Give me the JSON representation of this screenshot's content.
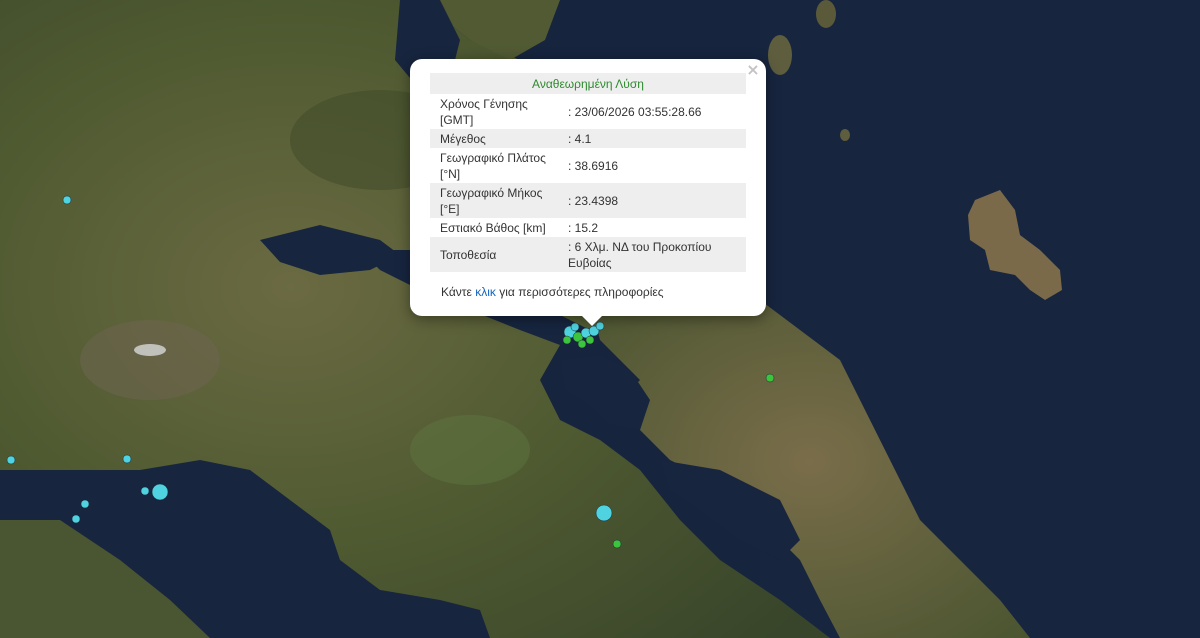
{
  "popup": {
    "title": "Αναθεωρημένη Λύση",
    "rows": [
      {
        "label": "Χρόνος Γένησης [GMT]",
        "value": ": 23/06/2026 03:55:28.66"
      },
      {
        "label": "Μέγεθος",
        "value": ": 4.1"
      },
      {
        "label": "Γεωγραφικό Πλάτος [°N]",
        "value": ": 38.6916"
      },
      {
        "label": "Γεωγραφικό Μήκος [°E]",
        "value": ": 23.4398"
      },
      {
        "label": "Εστιακό Βάθος [km]",
        "value": ": 15.2"
      },
      {
        "label": "Τοποθεσία",
        "value": ": 6 Χλμ. ΝΔ του Προκοπίου Ευβοίας"
      }
    ],
    "more_prefix": "Κάντε",
    "more_link": "κλικ",
    "more_suffix": "για περισσότερες πληροφορίες",
    "close": "×"
  },
  "colors": {
    "sea": "#15233d",
    "land": "#4e5a32",
    "marker_cyan": "#4fd3e0",
    "marker_green": "#3cc43c"
  }
}
